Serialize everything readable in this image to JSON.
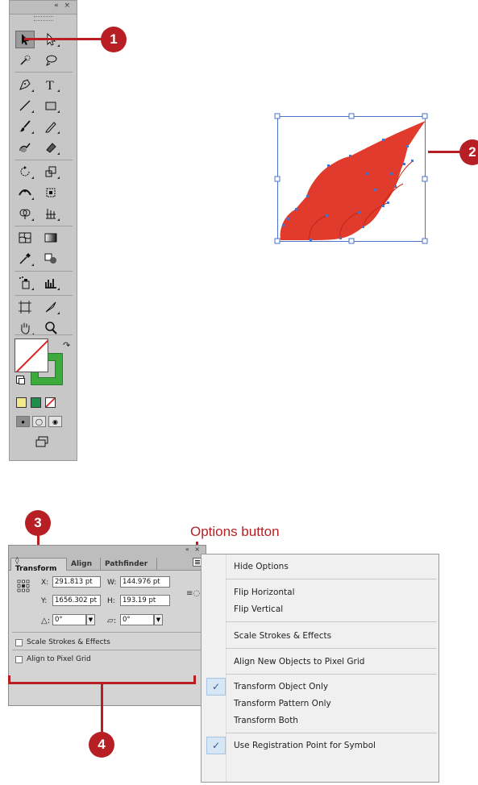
{
  "callouts": {
    "c1": "1",
    "c2": "2",
    "c3": "3",
    "c4": "4"
  },
  "colors": {
    "accent": "#b81f24",
    "wing_fill": "#e03b2c",
    "selection": "#4a72c9",
    "stroke_swatch": "#3caa3c"
  },
  "tools_panel": {
    "collapse_glyph": "« ×",
    "tools": [
      "selection-tool",
      "direct-selection-tool",
      "magic-wand-tool",
      "lasso-tool",
      "pen-tool",
      "type-tool",
      "line-segment-tool",
      "rectangle-tool",
      "paintbrush-tool",
      "pencil-tool",
      "blob-brush-tool",
      "eraser-tool",
      "rotate-tool",
      "scale-tool",
      "width-tool",
      "free-transform-tool",
      "shape-builder-tool",
      "perspective-grid-tool",
      "mesh-tool",
      "gradient-tool",
      "eyedropper-tool",
      "blend-tool",
      "symbol-sprayer-tool",
      "column-graph-tool",
      "artboard-tool",
      "slice-tool",
      "hand-tool",
      "zoom-tool"
    ],
    "color_modes": [
      "color",
      "gradient",
      "none"
    ],
    "draw_modes": [
      "draw-normal",
      "draw-behind",
      "draw-inside"
    ],
    "screen_mode_icon": "screen-mode-icon"
  },
  "options_button_label": "Options button",
  "transform_panel": {
    "collapse_glyph": "« ×",
    "tabs": [
      "◊ Transform",
      "Align",
      "Pathfinder"
    ],
    "x_label": "X:",
    "x_value": "291.813 pt",
    "y_label": "Y:",
    "y_value": "1656.302 pt",
    "w_label": "W:",
    "w_value": "144.976 pt",
    "h_label": "H:",
    "h_value": "193.19 pt",
    "rotate_value": "0°",
    "shear_value": "0°",
    "scale_strokes_label": "Scale Strokes & Effects",
    "align_pixel_label": "Align to Pixel Grid"
  },
  "options_menu": {
    "items": [
      "Hide Options",
      "Flip Horizontal",
      "Flip Vertical",
      "Scale Strokes & Effects",
      "Align New Objects to Pixel Grid",
      "Transform Object Only",
      "Transform Pattern Only",
      "Transform Both",
      "Use Registration Point for Symbol"
    ],
    "check_glyph": "✓"
  }
}
